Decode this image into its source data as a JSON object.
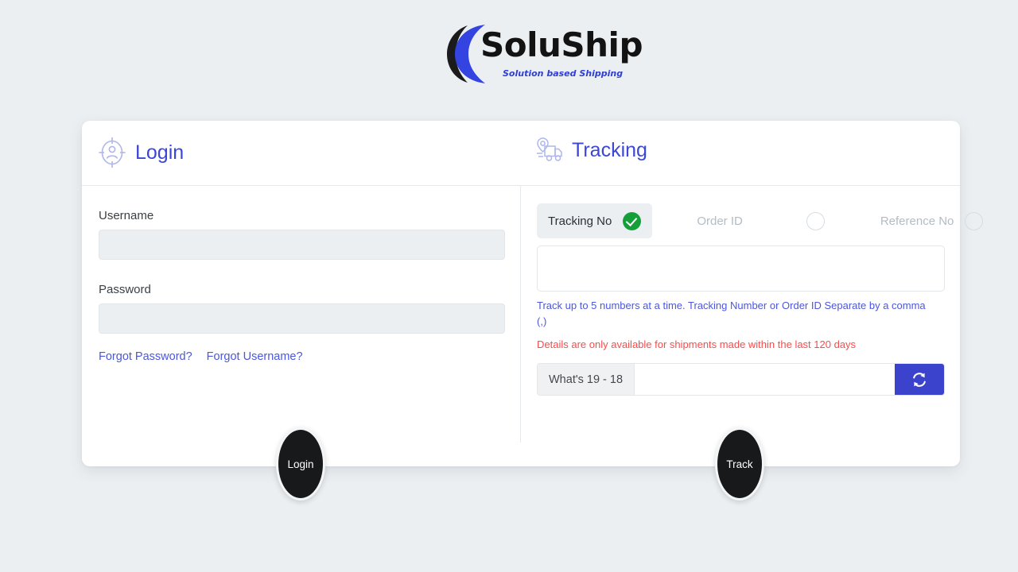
{
  "brand": {
    "name": "SoluShip",
    "tagline": "Solution based Shipping",
    "logo_icon": "swoosh-crescent-icon",
    "accent_blue": "#3b47d6",
    "swoosh_blue": "#3344e0",
    "swoosh_black": "#1b1b1b"
  },
  "login": {
    "icon": "user-target-icon",
    "title": "Login",
    "username_label": "Username",
    "username_value": "",
    "username_placeholder": "",
    "password_label": "Password",
    "password_value": "",
    "password_placeholder": "",
    "forgot_password_label": "Forgot Password?",
    "forgot_username_label": "Forgot Username?",
    "submit_label": "Login"
  },
  "tracking": {
    "icon": "delivery-truck-pin-icon",
    "title": "Tracking",
    "options": [
      {
        "label": "Tracking No",
        "selected": true
      },
      {
        "label": "Order ID",
        "selected": false
      },
      {
        "label": "Reference No",
        "selected": false
      }
    ],
    "numbers_value": "",
    "numbers_placeholder": "",
    "hint": "Track up to 5 numbers at a time. Tracking Number or Order ID Separate by a comma (,)",
    "warning": "Details are only available for shipments made within the last 120 days",
    "captcha_question": "What's 19 - 18",
    "captcha_value": "",
    "captcha_placeholder": "",
    "refresh_icon": "refresh-icon",
    "refresh_button_color": "#3b43cd",
    "submit_label": "Track",
    "selected_check_color": "#14a038",
    "warning_color": "#fa4b4b"
  }
}
